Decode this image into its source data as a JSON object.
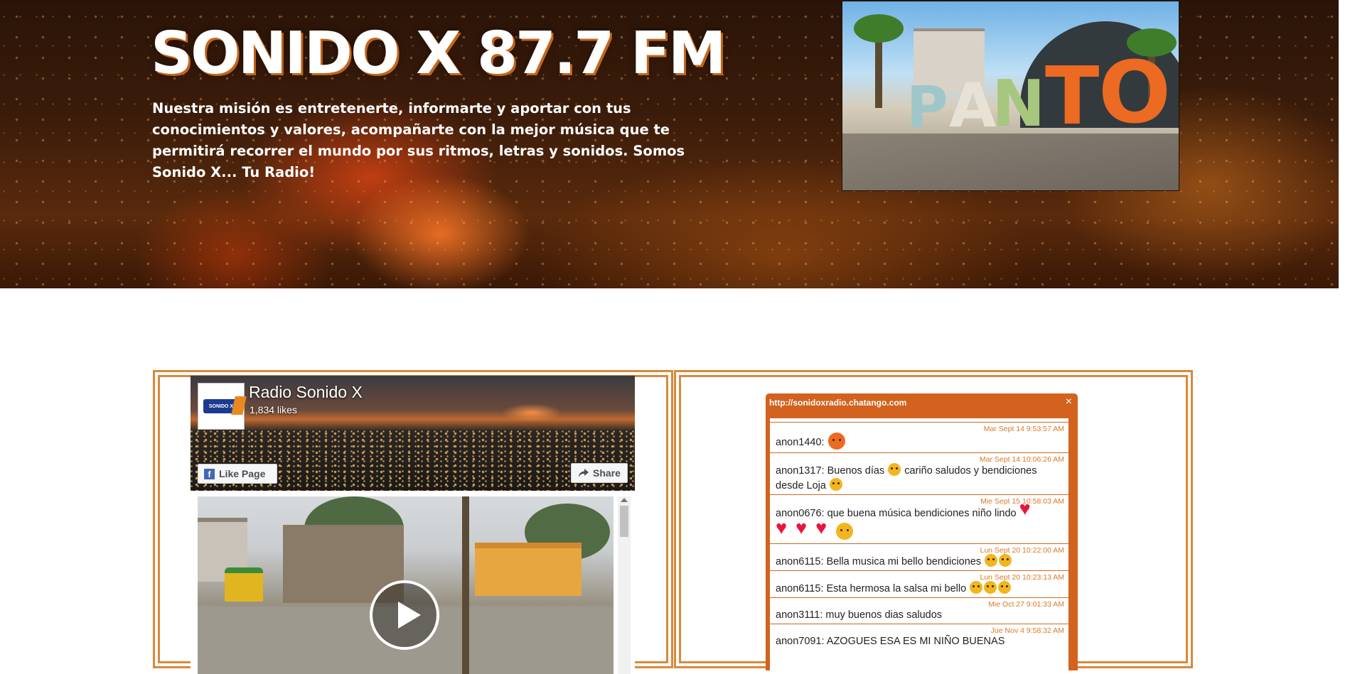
{
  "hero": {
    "title": "SONIDO X 87.7 FM",
    "mission": "Nuestra misión es entretenerte, informarte y aportar con tus conocimientos y valores, acompañarte con la mejor música que te permitirá recorrer el mundo por sus ritmos, letras y sonidos. Somos Sonido X... Tu Radio!",
    "photo_letters": [
      "P",
      "A",
      "N",
      "T",
      "O"
    ]
  },
  "facebook": {
    "page_name": "Radio Sonido X",
    "likes": "1,834 likes",
    "like_button": "Like Page",
    "share_button": "Share",
    "logo_text": "SONIDO X"
  },
  "chat": {
    "url": "http://sonidoxradio.chatango.com",
    "close_label": "×",
    "messages": [
      {
        "timestamp": "Mar Sept 14 9:53:57 AM",
        "user": "anon1440:",
        "text": "",
        "emojis": [
          "angry"
        ]
      },
      {
        "timestamp": "Mar Sept 14 10:06:26 AM",
        "user": "anon1317:",
        "text": "Buenos días",
        "text_after": "cariño saludos y bendiciones desde Loja",
        "emojis": [
          "smile",
          "smile"
        ]
      },
      {
        "timestamp": "Mie Sept 15 10:58:03 AM",
        "user": "anon0676:",
        "text": "que buena música bendiciones niño lindo",
        "emojis": [
          "heart",
          "heart",
          "heart",
          "heart",
          "kiss"
        ]
      },
      {
        "timestamp": "Lun Sept 20 10:22:00 AM",
        "user": "anon6115:",
        "text": "Bella musica mi bello bendiciones",
        "emojis": [
          "smile",
          "smile"
        ]
      },
      {
        "timestamp": "Lun Sept 20 10:23:13 AM",
        "user": "anon6115:",
        "text": "Esta hermosa la salsa mi bello",
        "emojis": [
          "smile",
          "smile",
          "smile"
        ]
      },
      {
        "timestamp": "Mie Oct 27 9:01:33 AM",
        "user": "anon3111:",
        "text": "muy buenos dias saludos",
        "emojis": []
      },
      {
        "timestamp": "Jue Nov 4 9:58:32 AM",
        "user": "anon7091:",
        "text": "AZOGUES ESA ES MI NIÑO BUENAS",
        "emojis": []
      }
    ]
  },
  "colors": {
    "accent": "#d98a3a",
    "chat_orange": "#d2621e",
    "fb_blue": "#4267b2"
  }
}
